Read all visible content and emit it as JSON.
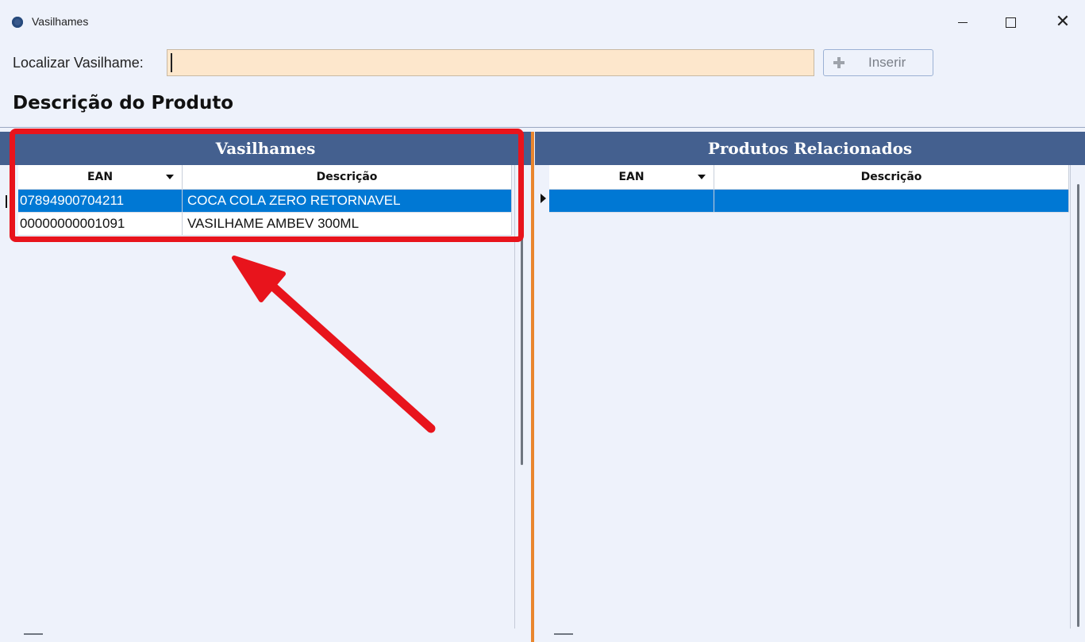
{
  "window": {
    "title": "Vasilhames",
    "controls": {
      "minimize": "—",
      "maximize": "☐",
      "close": "✕"
    }
  },
  "search": {
    "label": "Localizar Vasilhame:",
    "value": "",
    "placeholder": ""
  },
  "insert_button": {
    "label": "Inserir",
    "icon": "plus-icon"
  },
  "section_title": "Descrição do Produto",
  "left_panel": {
    "title": "Vasilhames",
    "columns": [
      "EAN",
      "Descrição"
    ],
    "rows": [
      {
        "ean": "07894900704211",
        "descricao": "COCA COLA ZERO RETORNAVEL",
        "selected": true
      },
      {
        "ean": "00000000001091",
        "descricao": "VASILHAME AMBEV 300ML",
        "selected": false
      }
    ]
  },
  "right_panel": {
    "title": "Produtos Relacionados",
    "columns": [
      "EAN",
      "Descrição"
    ],
    "rows": [
      {
        "ean": "",
        "descricao": "",
        "selected": true
      }
    ]
  },
  "colors": {
    "panel_header": "#44608f",
    "selection": "#0078d4",
    "search_bg": "#fde7cc",
    "annotation": "#e8141c",
    "divider": "#e9862e"
  }
}
